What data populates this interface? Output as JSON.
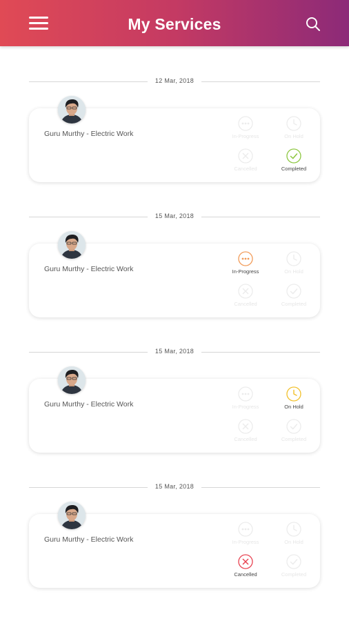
{
  "header": {
    "title": "My Services"
  },
  "labels": {
    "in_progress": "In-Progress",
    "on_hold": "On Hold",
    "cancelled": "Cancelled",
    "completed": "Completed"
  },
  "colors": {
    "in_progress": "#f29b58",
    "on_hold": "#f2c029",
    "cancelled": "#e8404f",
    "completed": "#8cc63f",
    "inactive": "#ececec"
  },
  "services": [
    {
      "date": "12 Mar, 2018",
      "name": "Guru Murthy - Electric Work",
      "status": "completed"
    },
    {
      "date": "15 Mar, 2018",
      "name": "Guru Murthy - Electric Work",
      "status": "in_progress"
    },
    {
      "date": "15 Mar, 2018",
      "name": "Guru Murthy - Electric Work",
      "status": "on_hold"
    },
    {
      "date": "15 Mar, 2018",
      "name": "Guru Murthy - Electric Work",
      "status": "cancelled"
    }
  ]
}
